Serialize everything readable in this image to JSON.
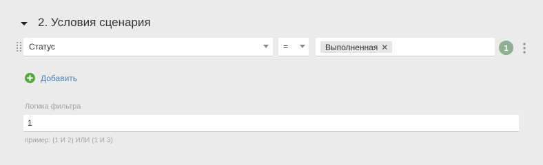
{
  "section": {
    "title": "2. Условия сценария"
  },
  "condition": {
    "number": "1",
    "field": {
      "value": "Статус"
    },
    "operator": {
      "value": "="
    },
    "values": [
      {
        "label": "Выполненная"
      }
    ]
  },
  "actions": {
    "add_label": "Добавить"
  },
  "filter_logic": {
    "label": "Логика фильтра",
    "value": "1",
    "hint": "пример: (1 И 2) ИЛИ (1 И 3)"
  },
  "colors": {
    "background": "#ebebeb",
    "link": "#4a7fb5",
    "add_icon": "#57a83d",
    "number_badge": "#8fae93"
  }
}
